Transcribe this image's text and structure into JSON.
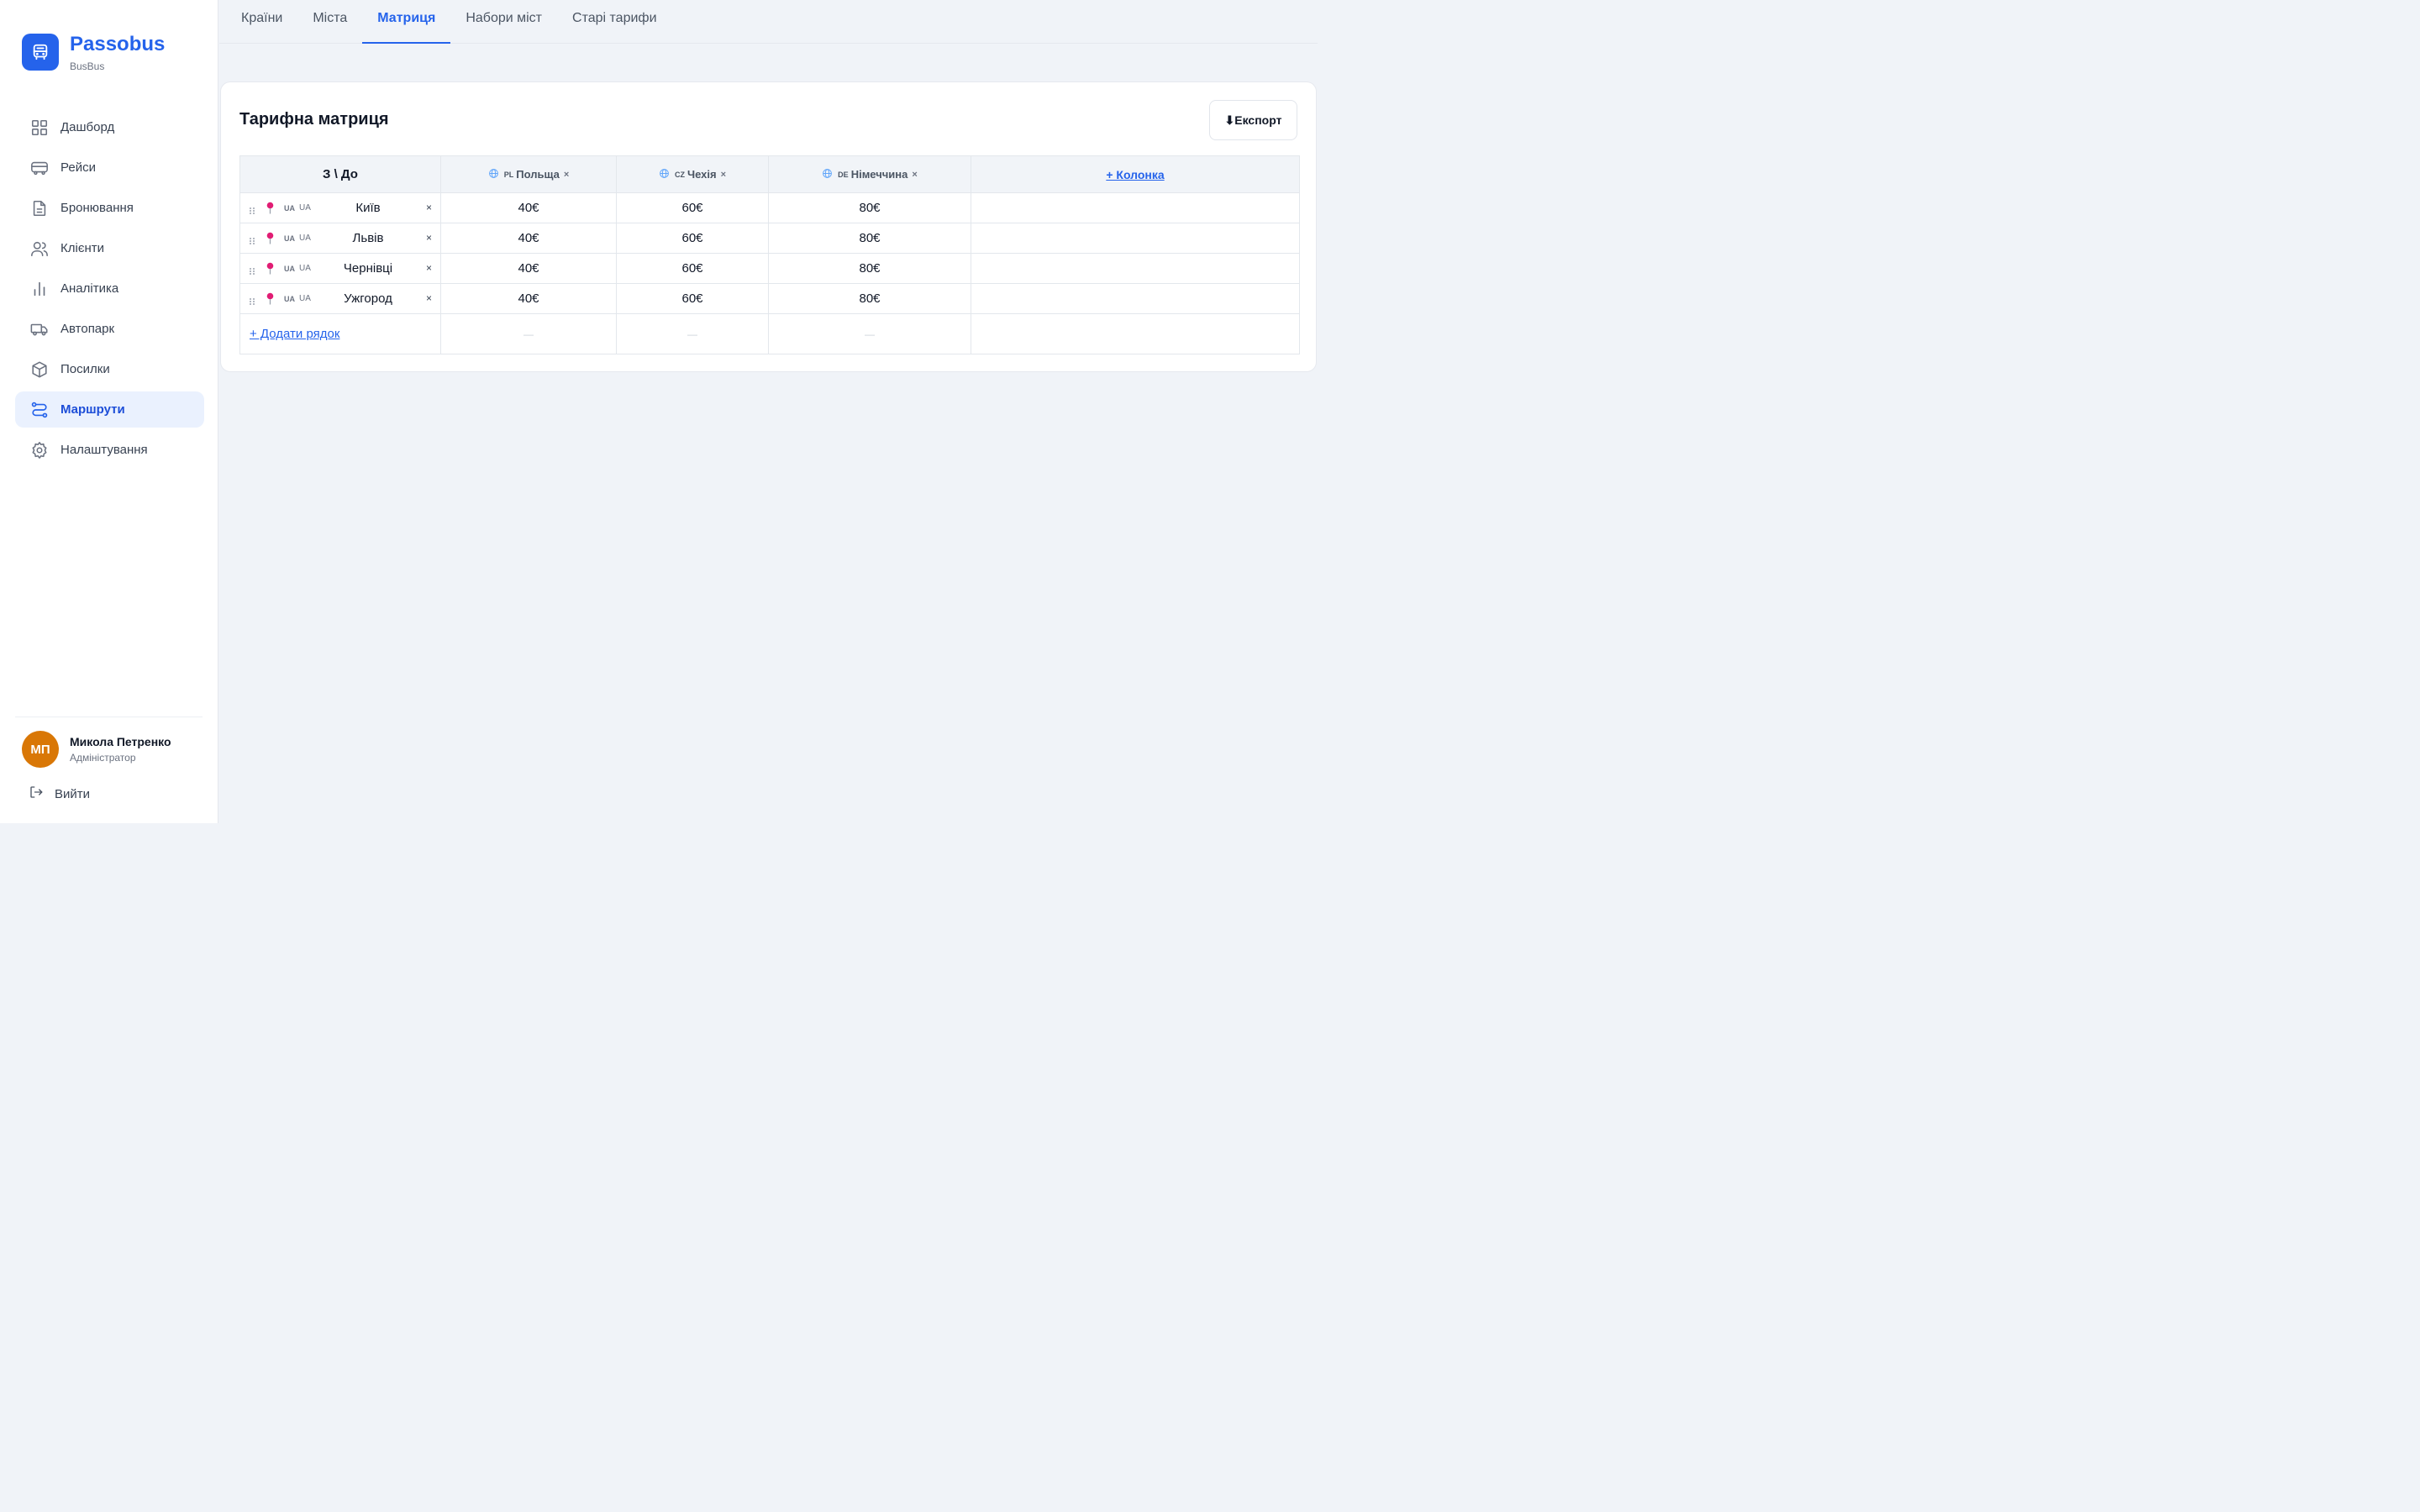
{
  "brand": {
    "name": "Passobus",
    "subtitle": "BusBus"
  },
  "nav": [
    {
      "label": "Дашборд",
      "icon": "grid-icon",
      "active": false
    },
    {
      "label": "Рейси",
      "icon": "bus-icon",
      "active": false
    },
    {
      "label": "Бронювання",
      "icon": "document-icon",
      "active": false
    },
    {
      "label": "Клієнти",
      "icon": "users-icon",
      "active": false
    },
    {
      "label": "Аналітика",
      "icon": "bar-chart-icon",
      "active": false
    },
    {
      "label": "Автопарк",
      "icon": "truck-icon",
      "active": false
    },
    {
      "label": "Посилки",
      "icon": "package-icon",
      "active": false
    },
    {
      "label": "Маршрути",
      "icon": "route-icon",
      "active": true
    },
    {
      "label": "Налаштування",
      "icon": "gear-icon",
      "active": false
    }
  ],
  "user": {
    "initials": "МП",
    "name": "Микола Петренко",
    "role": "Адміністратор"
  },
  "logout_label": "Вийти",
  "tabs": [
    {
      "label": "Країни",
      "active": false
    },
    {
      "label": "Міста",
      "active": false
    },
    {
      "label": "Матриця",
      "active": true
    },
    {
      "label": "Набори міст",
      "active": false
    },
    {
      "label": "Старі тарифи",
      "active": false
    }
  ],
  "card": {
    "title": "Тарифна матриця",
    "export_label": "⬇Експорт",
    "corner_label": "З \\ До",
    "columns": [
      {
        "code": "PL",
        "name": "Польща"
      },
      {
        "code": "CZ",
        "name": "Чехія"
      },
      {
        "code": "DE",
        "name": "Німеччина"
      }
    ],
    "add_column_label": "+ Колонка",
    "rows": [
      {
        "cc1": "UA",
        "cc2": "UA",
        "city": "Київ",
        "prices": [
          "40€",
          "60€",
          "80€"
        ]
      },
      {
        "cc1": "UA",
        "cc2": "UA",
        "city": "Львів",
        "prices": [
          "40€",
          "60€",
          "80€"
        ]
      },
      {
        "cc1": "UA",
        "cc2": "UA",
        "city": "Чернівці",
        "prices": [
          "40€",
          "60€",
          "80€"
        ]
      },
      {
        "cc1": "UA",
        "cc2": "UA",
        "city": "Ужгород",
        "prices": [
          "40€",
          "60€",
          "80€"
        ]
      }
    ],
    "add_row_label": "+ Додати рядок",
    "empty_cell": "—",
    "remove_symbol": "×"
  },
  "colors": {
    "accent": "#2563eb",
    "avatar": "#d97706",
    "pin": "#e11d74"
  }
}
